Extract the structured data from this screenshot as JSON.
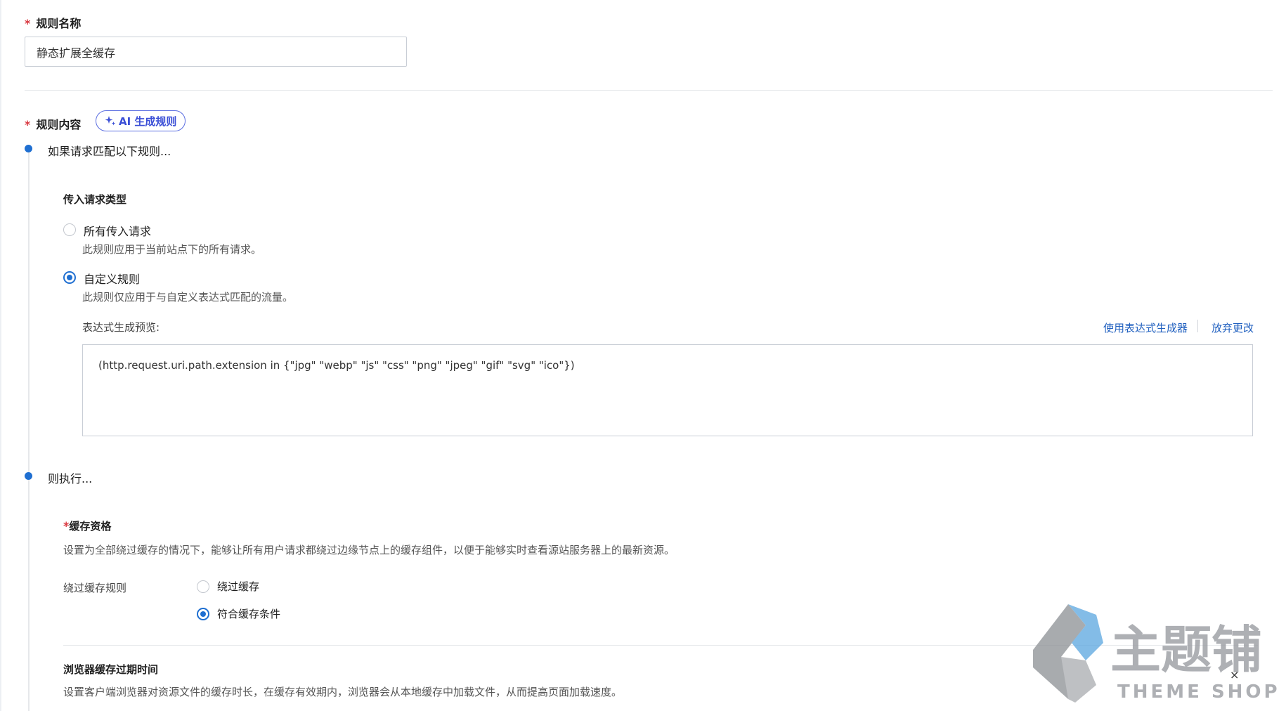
{
  "rule_name": {
    "label": "规则名称",
    "required_mark": "*",
    "value": "静态扩展全缓存"
  },
  "rule_content": {
    "label": "规则内容",
    "required_mark": "*",
    "ai_button_label": "AI 生成规则"
  },
  "step_if": {
    "title": "如果请求匹配以下规则...",
    "request_type_heading": "传入请求类型",
    "option_all": {
      "label": "所有传入请求",
      "desc": "此规则应用于当前站点下的所有请求。",
      "checked": false
    },
    "option_custom": {
      "label": "自定义规则",
      "desc": "此规则仅应用于与自定义表达式匹配的流量。",
      "checked": true
    },
    "expression_preview_label": "表达式生成预览:",
    "use_builder_link": "使用表达式生成器",
    "discard_link": "放弃更改",
    "expression": "(http.request.uri.path.extension in {\"jpg\" \"webp\" \"js\" \"css\" \"png\" \"jpeg\" \"gif\" \"svg\" \"ico\"})"
  },
  "step_then": {
    "title": "则执行...",
    "cache_eligibility": {
      "required_mark": "*",
      "heading": "缓存资格",
      "desc": "设置为全部绕过缓存的情况下，能够让所有用户请求都绕过边缘节点上的缓存组件，以便于能够实时查看源站服务器上的最新资源。",
      "bypass_rule_label": "绕过缓存规则",
      "option_bypass": {
        "label": "绕过缓存",
        "checked": false
      },
      "option_eligible": {
        "label": "符合缓存条件",
        "checked": true
      }
    },
    "browser_cache": {
      "heading": "浏览器缓存过期时间",
      "desc": "设置客户端浏览器对资源文件的缓存时长，在缓存有效期内，浏览器会从本地缓存中加载文件，从而提高页面加载速度。"
    }
  },
  "watermark": {
    "brand_cn": "主题铺",
    "brand_en": "THEME SHOP"
  },
  "colors": {
    "accent": "#1f6fd1",
    "link": "#1f5fbf",
    "required": "#d9363e",
    "ai_button": "#3b4fd6"
  }
}
